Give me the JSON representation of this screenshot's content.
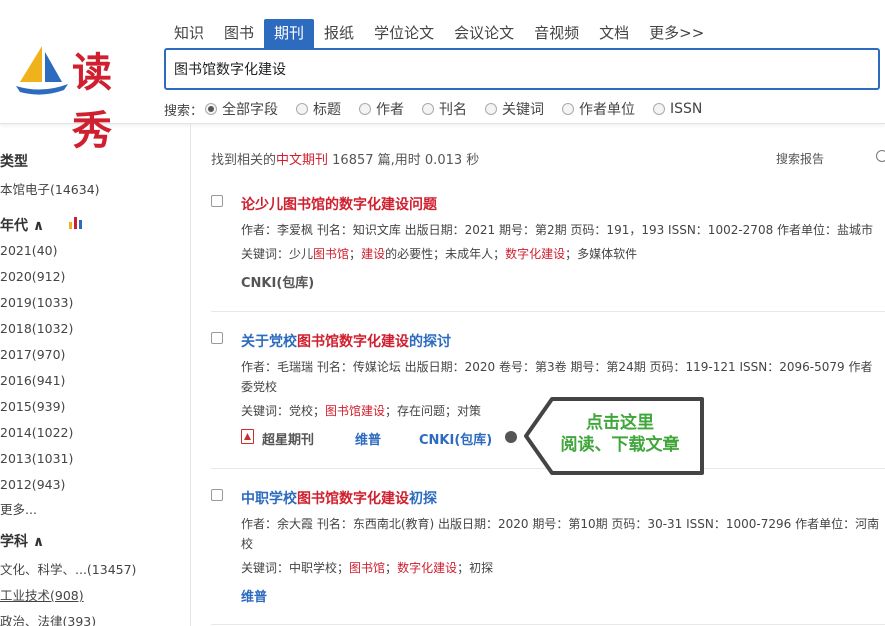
{
  "logo": {
    "text": "读秀"
  },
  "nav_tabs": [
    "知识",
    "图书",
    "期刊",
    "报纸",
    "学位论文",
    "会议论文",
    "音视频",
    "文档",
    "更多>>"
  ],
  "active_tab_index": 2,
  "search": {
    "value": "图书馆数字化建设"
  },
  "scope": {
    "label": "搜索：",
    "options": [
      "全部字段",
      "标题",
      "作者",
      "刊名",
      "关键词",
      "作者单位",
      "ISSN"
    ],
    "selected": "全部字段"
  },
  "sidebar": {
    "type_title": "类型",
    "type_item": "本馆电子(14634)",
    "year_title": "年代 ∧",
    "years": [
      "2021(40)",
      "2020(912)",
      "2019(1033)",
      "2018(1032)",
      "2017(970)",
      "2016(941)",
      "2015(939)",
      "2014(1022)",
      "2013(1031)",
      "2012(943)"
    ],
    "more": "更多...",
    "subject_title": "学科 ∧",
    "subjects": [
      "文化、科学、...(13457)",
      "工业技术(908)",
      "政治、法律(393)"
    ]
  },
  "summary": {
    "prefix": "找到相关的",
    "type": "中文期刊",
    "suffix": " 16857 篇,用时 0.013 秒"
  },
  "report_label": "搜索报告",
  "results": [
    {
      "title": "论少儿图书馆的数字化建设问题",
      "meta": "作者：李爱枫  刊名：知识文库  出版日期：2021  期号：第2期  页码：191，193  ISSN：1002-2708  作者单位：盐城市",
      "kw_label": "关键词：",
      "kw_parts": [
        "少儿",
        "图书馆",
        "；",
        "建设",
        "的必要性；未成年人；",
        "数字化建设",
        "；多媒体软件"
      ],
      "sources": [
        "CNKI(包库)"
      ]
    },
    {
      "title_parts": [
        "关于党校",
        "图书馆数字化建设",
        "的探讨"
      ],
      "meta": "作者：毛瑞瑞  刊名：传媒论坛  出版日期：2020  卷号：第3卷  期号：第24期  页码：119-121  ISSN：2096-5079  作者",
      "meta_extra": "委党校",
      "kw_label": "关键词：",
      "kw_parts": [
        "党校；",
        "图书馆建设",
        "；存在问题；对策"
      ],
      "sources": [
        "超星期刊",
        "维普",
        "CNKI(包库)"
      ]
    },
    {
      "title_parts": [
        "中职学校",
        "图书馆数字化建设",
        "初探"
      ],
      "meta": "作者：余大霞  刊名：东西南北(教育)  出版日期：2020  期号：第10期  页码：30-31  ISSN：1000-7296  作者单位：河南",
      "meta_extra": "校",
      "kw_label": "关键词：",
      "kw_parts": [
        "中职学校；",
        "图书馆",
        "；",
        "数字化建设",
        "；初探"
      ],
      "sources": [
        "维普"
      ]
    }
  ],
  "callout": {
    "line1": "点击这里",
    "line2": "阅读、下载文章"
  },
  "colors": {
    "accent": "#2d6bbf",
    "highlight": "#d0202f",
    "callout_text": "#3fa63a"
  }
}
